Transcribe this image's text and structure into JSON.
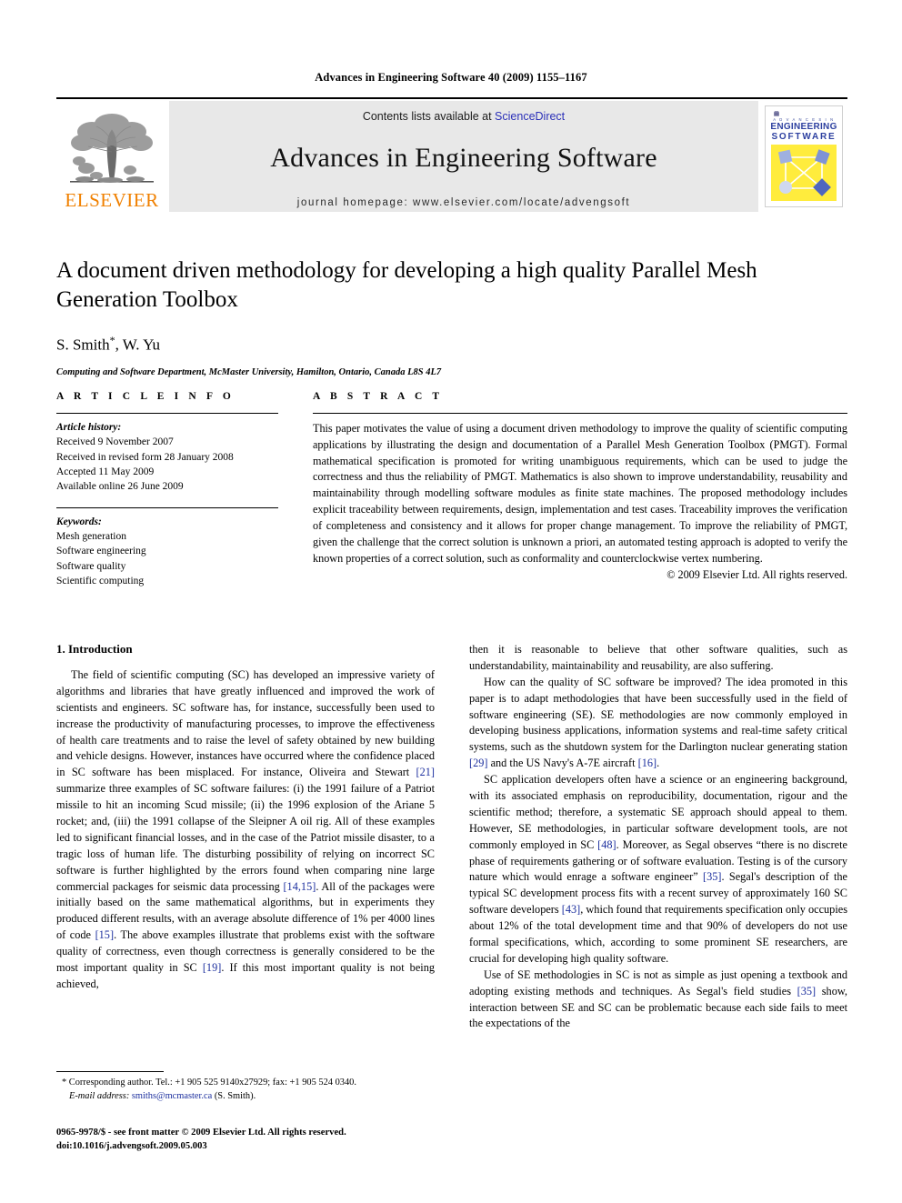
{
  "running_head": "Advances in Engineering Software 40 (2009) 1155–1167",
  "masthead": {
    "publisher_name": "ELSEVIER",
    "contents_prefix": "Contents lists available at ",
    "contents_link": "ScienceDirect",
    "journal_title": "Advances in Engineering Software",
    "homepage": "journal homepage: www.elsevier.com/locate/advengsoft",
    "cover": {
      "sub": "A D V A N C E S   I N",
      "line1": "ENGINEERING",
      "line2": "SOFTWARE"
    }
  },
  "title_block": {
    "title": "A document driven methodology for developing a high quality Parallel Mesh Generation Toolbox",
    "authors": "S. Smith",
    "authors_star": "*",
    "authors_rest": ", W. Yu",
    "affiliation": "Computing and Software Department, McMaster University, Hamilton, Ontario, Canada L8S 4L7"
  },
  "article_info": {
    "heading": "A R T I C L E    I N F O",
    "history_label": "Article history:",
    "history": [
      "Received 9 November 2007",
      "Received in revised form 28 January 2008",
      "Accepted 11 May 2009",
      "Available online 26 June 2009"
    ],
    "keywords_label": "Keywords:",
    "keywords": [
      "Mesh generation",
      "Software engineering",
      "Software quality",
      "Scientific computing"
    ]
  },
  "abstract": {
    "heading": "A B S T R A C T",
    "text": "This paper motivates the value of using a document driven methodology to improve the quality of scientific computing applications by illustrating the design and documentation of a Parallel Mesh Generation Toolbox (PMGT). Formal mathematical specification is promoted for writing unambiguous requirements, which can be used to judge the correctness and thus the reliability of PMGT. Mathematics is also shown to improve understandability, reusability and maintainability through modelling software modules as finite state machines. The proposed methodology includes explicit traceability between requirements, design, implementation and test cases. Traceability improves the verification of completeness and consistency and it allows for proper change management. To improve the reliability of PMGT, given the challenge that the correct solution is unknown a priori, an automated testing approach is adopted to verify the known properties of a correct solution, such as conformality and counterclockwise vertex numbering.",
    "copyright": "© 2009 Elsevier Ltd. All rights reserved."
  },
  "body": {
    "section_title": "1. Introduction",
    "left_paragraphs": [
      {
        "parts": [
          {
            "t": "The field of scientific computing (SC) has developed an impressive variety of algorithms and libraries that have greatly influenced and improved the work of scientists and engineers. SC software has, for instance, successfully been used to increase the productivity of manufacturing processes, to improve the effectiveness of health care treatments and to raise the level of safety obtained by new building and vehicle designs. However, instances have occurred where the confidence placed in SC software has been misplaced. For instance, Oliveira and Stewart "
          },
          {
            "t": "[21]",
            "ref": true
          },
          {
            "t": " summarize three examples of SC software failures: (i) the 1991 failure of a Patriot missile to hit an incoming Scud missile; (ii) the 1996 explosion of the Ariane 5 rocket; and, (iii) the 1991 collapse of the Sleipner A oil rig. All of these examples led to significant financial losses, and in the case of the Patriot missile disaster, to a tragic loss of human life. The disturbing possibility of relying on incorrect SC software is further highlighted by the errors found when comparing nine large commercial packages for seismic data processing "
          },
          {
            "t": "[14,15]",
            "ref": true
          },
          {
            "t": ". All of the packages were initially based on the same mathematical algorithms, but in experiments they produced different results, with an average absolute difference of 1% per 4000 lines of code "
          },
          {
            "t": "[15]",
            "ref": true
          },
          {
            "t": ". The above examples illustrate that problems exist with the software quality of correctness, even though correctness is generally considered to be the most important quality in SC "
          },
          {
            "t": "[19]",
            "ref": true
          },
          {
            "t": ". If this most important quality is not being achieved,"
          }
        ]
      }
    ],
    "right_paragraphs": [
      {
        "indent": false,
        "parts": [
          {
            "t": "then it is reasonable to believe that other software qualities, such as understandability, maintainability and reusability, are also suffering."
          }
        ]
      },
      {
        "indent": true,
        "parts": [
          {
            "t": "How can the quality of SC software be improved? The idea promoted in this paper is to adapt methodologies that have been successfully used in the field of software engineering (SE). SE methodologies are now commonly employed in developing business applications, information systems and real-time safety critical systems, such as the shutdown system for the Darlington nuclear generating station "
          },
          {
            "t": "[29]",
            "ref": true
          },
          {
            "t": " and the US Navy's A-7E aircraft "
          },
          {
            "t": "[16]",
            "ref": true
          },
          {
            "t": "."
          }
        ]
      },
      {
        "indent": true,
        "parts": [
          {
            "t": "SC application developers often have a science or an engineering background, with its associated emphasis on reproducibility, documentation, rigour and the scientific method; therefore, a systematic SE approach should appeal to them. However, SE methodologies, in particular software development tools, are not commonly employed in SC "
          },
          {
            "t": "[48]",
            "ref": true
          },
          {
            "t": ". Moreover, as Segal observes “there is no discrete phase of requirements gathering or of software evaluation. Testing is of the cursory nature which would enrage a software engineer” "
          },
          {
            "t": "[35]",
            "ref": true
          },
          {
            "t": ". Segal's description of the typical SC development process fits with a recent survey of approximately 160 SC software developers "
          },
          {
            "t": "[43]",
            "ref": true
          },
          {
            "t": ", which found that requirements specification only occupies about 12% of the total development time and that 90% of developers do not use formal specifications, which, according to some prominent SE researchers, are crucial for developing high quality software."
          }
        ]
      },
      {
        "indent": true,
        "parts": [
          {
            "t": "Use of SE methodologies in SC is not as simple as just opening a textbook and adopting existing methods and techniques. As Segal's field studies "
          },
          {
            "t": "[35]",
            "ref": true
          },
          {
            "t": " show, interaction between SE and SC can be problematic because each side fails to meet the expectations of the"
          }
        ]
      }
    ]
  },
  "footnote": {
    "marker": "*",
    "line1": " Corresponding author. Tel.: +1 905 525 9140x27929; fax: +1 905 524 0340.",
    "email_label": "E-mail address:",
    "email": "smiths@mcmaster.ca",
    "email_suffix": " (S. Smith)."
  },
  "footer": {
    "line1": "0965-9978/$ - see front matter © 2009 Elsevier Ltd. All rights reserved.",
    "line2": "doi:10.1016/j.advengsoft.2009.05.003"
  },
  "colors": {
    "link": "#2b30b8",
    "reference": "#1c2f9e",
    "elsevier_orange": "#F08000",
    "cover_yellow": "#ffec3d",
    "cover_blue": "#2d40a0"
  }
}
